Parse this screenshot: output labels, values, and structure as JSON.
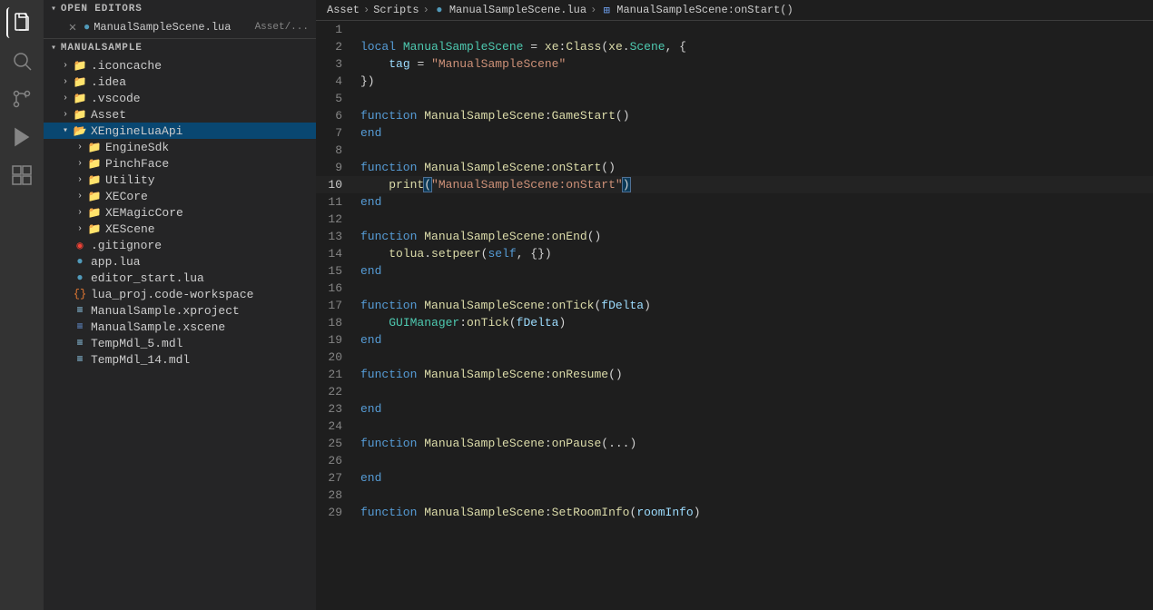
{
  "activityBar": {
    "icons": [
      {
        "name": "files-icon",
        "symbol": "⧉",
        "active": true
      },
      {
        "name": "search-icon",
        "symbol": "🔍"
      },
      {
        "name": "source-control-icon",
        "symbol": "⑂"
      },
      {
        "name": "run-icon",
        "symbol": "▶"
      },
      {
        "name": "extensions-icon",
        "symbol": "⊞"
      }
    ]
  },
  "sidebar": {
    "openEditors": {
      "label": "OPEN EDITORS",
      "tabs": [
        {
          "name": "ManualSampleScene.lua",
          "path": "Asset/...",
          "iconType": "lua"
        }
      ]
    },
    "explorer": {
      "rootLabel": "MANUALSAMPLE",
      "items": [
        {
          "id": "iconcache",
          "label": ".iconcache",
          "type": "folder",
          "depth": 1,
          "expanded": false
        },
        {
          "id": "idea",
          "label": ".idea",
          "type": "folder",
          "depth": 1,
          "expanded": false
        },
        {
          "id": "vscode",
          "label": ".vscode",
          "type": "folder",
          "depth": 1,
          "expanded": false
        },
        {
          "id": "asset",
          "label": "Asset",
          "type": "folder",
          "depth": 1,
          "expanded": false
        },
        {
          "id": "xengineluaapi",
          "label": "XEngineLuaApi",
          "type": "folder",
          "depth": 1,
          "expanded": true
        },
        {
          "id": "enginesdk",
          "label": "EngineSdk",
          "type": "folder",
          "depth": 2,
          "expanded": false
        },
        {
          "id": "pinchface",
          "label": "PinchFace",
          "type": "folder",
          "depth": 2,
          "expanded": false
        },
        {
          "id": "utility",
          "label": "Utility",
          "type": "folder",
          "depth": 2,
          "expanded": false
        },
        {
          "id": "xecore",
          "label": "XECore",
          "type": "folder",
          "depth": 2,
          "expanded": false
        },
        {
          "id": "xemagiccore",
          "label": "XEMagicCore",
          "type": "folder",
          "depth": 2,
          "expanded": false
        },
        {
          "id": "xescene",
          "label": "XEScene",
          "type": "folder",
          "depth": 2,
          "expanded": false
        },
        {
          "id": "gitignore",
          "label": ".gitignore",
          "type": "file",
          "depth": 1,
          "iconType": "git"
        },
        {
          "id": "applua",
          "label": "app.lua",
          "type": "file",
          "depth": 1,
          "iconType": "lua"
        },
        {
          "id": "editorstartlua",
          "label": "editor_start.lua",
          "type": "file",
          "depth": 1,
          "iconType": "lua"
        },
        {
          "id": "luaprojworkspace",
          "label": "lua_proj.code-workspace",
          "type": "file",
          "depth": 1,
          "iconType": "workspace"
        },
        {
          "id": "manualsamplexproject",
          "label": "ManualSample.xproject",
          "type": "file",
          "depth": 1,
          "iconType": "xproj"
        },
        {
          "id": "manualsamplexscene",
          "label": "ManualSample.xscene",
          "type": "file",
          "depth": 1,
          "iconType": "scene"
        },
        {
          "id": "tempmdl5",
          "label": "TempMdl_5.mdl",
          "type": "file",
          "depth": 1,
          "iconType": "mdl"
        },
        {
          "id": "tempmdl14",
          "label": "TempMdl_14.mdl",
          "type": "file",
          "depth": 1,
          "iconType": "mdl"
        }
      ]
    }
  },
  "breadcrumb": {
    "items": [
      {
        "label": "Asset",
        "type": "text"
      },
      {
        "label": "Scripts",
        "type": "text"
      },
      {
        "label": "ManualSampleScene.lua",
        "type": "lua"
      },
      {
        "label": "ManualSampleScene:onStart()",
        "type": "method"
      }
    ]
  },
  "editor": {
    "filename": "ManualSampleScene.lua",
    "lines": [
      {
        "num": 1,
        "content": ""
      },
      {
        "num": 2,
        "html": "<span class='kw'>local</span> <span class='cls'>ManualSampleScene</span> <span class='op'>=</span> <span class='fn'>xe</span><span class='punct'>:</span><span class='fn'>Class</span><span class='punct'>(</span><span class='fn'>xe</span><span class='punct'>.</span><span class='cls'>Scene</span><span class='punct'>, {</span>"
      },
      {
        "num": 3,
        "html": "    <span class='var'>tag</span> <span class='op'>=</span> <span class='str'>\"ManualSampleScene\"</span>"
      },
      {
        "num": 4,
        "html": "<span class='punct'>})</span>"
      },
      {
        "num": 5,
        "content": ""
      },
      {
        "num": 6,
        "html": "<span class='kw'>function</span> <span class='fn'>ManualSampleScene</span><span class='punct'>:</span><span class='fn'>GameStart</span><span class='punct'>()</span>"
      },
      {
        "num": 7,
        "html": "<span class='kw'>end</span>"
      },
      {
        "num": 8,
        "content": ""
      },
      {
        "num": 9,
        "html": "<span class='kw'>function</span> <span class='fn'>ManualSampleScene</span><span class='punct'>:</span><span class='fn'>onStart</span><span class='punct'>()</span>"
      },
      {
        "num": 10,
        "html": "    <span class='fn'>print</span><span class='bracket-match'>(</span><span class='str'>\"ManualSampleScene:onStart\"</span><span class='bracket-match'>)</span>",
        "active": true
      },
      {
        "num": 11,
        "html": "<span class='kw'>end</span>"
      },
      {
        "num": 12,
        "content": ""
      },
      {
        "num": 13,
        "html": "<span class='kw'>function</span> <span class='fn'>ManualSampleScene</span><span class='punct'>:</span><span class='fn'>onEnd</span><span class='punct'>()</span>"
      },
      {
        "num": 14,
        "html": "    <span class='fn'>tolua</span><span class='punct'>.</span><span class='fn'>setpeer</span><span class='punct'>(</span><span class='self-kw'>self</span><span class='punct'>, {})</span>"
      },
      {
        "num": 15,
        "html": "<span class='kw'>end</span>"
      },
      {
        "num": 16,
        "content": ""
      },
      {
        "num": 17,
        "html": "<span class='kw'>function</span> <span class='fn'>ManualSampleScene</span><span class='punct'>:</span><span class='fn'>onTick</span><span class='punct'>(</span><span class='param'>fDelta</span><span class='punct'>)</span>"
      },
      {
        "num": 18,
        "html": "    <span class='cls'>GUIManager</span><span class='punct'>:</span><span class='fn'>onTick</span><span class='punct'>(</span><span class='param'>fDelta</span><span class='punct'>)</span>"
      },
      {
        "num": 19,
        "html": "<span class='kw'>end</span>"
      },
      {
        "num": 20,
        "content": ""
      },
      {
        "num": 21,
        "html": "<span class='kw'>function</span> <span class='fn'>ManualSampleScene</span><span class='punct'>:</span><span class='fn'>onResume</span><span class='punct'>()</span>"
      },
      {
        "num": 22,
        "content": ""
      },
      {
        "num": 23,
        "html": "<span class='kw'>end</span>"
      },
      {
        "num": 24,
        "content": ""
      },
      {
        "num": 25,
        "html": "<span class='kw'>function</span> <span class='fn'>ManualSampleScene</span><span class='punct'>:</span><span class='fn'>onPause</span><span class='punct'>(...)</span>"
      },
      {
        "num": 26,
        "content": ""
      },
      {
        "num": 27,
        "html": "<span class='kw'>end</span>"
      },
      {
        "num": 28,
        "content": ""
      },
      {
        "num": 29,
        "html": "<span class='kw'>function</span> <span class='fn'>ManualSampleScene</span><span class='punct'>:</span><span class='fn'>SetRoomInfo</span><span class='punct'>(</span><span class='param'>roomInfo</span><span class='punct'>)</span>"
      }
    ]
  }
}
